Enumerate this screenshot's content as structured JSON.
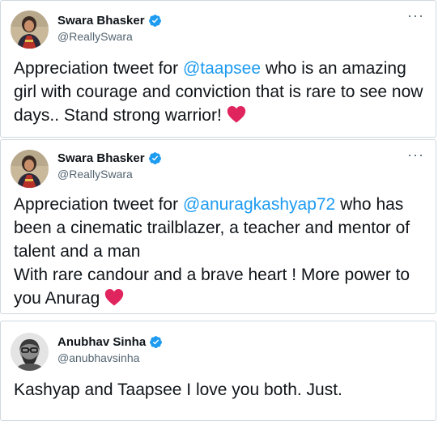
{
  "tweets": [
    {
      "author": "Swara Bhasker",
      "handle": "@ReallySwara",
      "more_label": "···",
      "text_before": "Appreciation tweet for ",
      "mention": "@taapsee",
      "text_after": " who is an amazing girl with courage and conviction that is rare to see now days.. Stand strong warrior!",
      "emoji": "red-heart",
      "avatar": "woman-portrait-avatar"
    },
    {
      "author": "Swara Bhasker",
      "handle": "@ReallySwara",
      "more_label": "···",
      "text_before": "Appreciation tweet for ",
      "mention": "@anuragkashyap72",
      "text_after": " who has been a cinematic trailblazer, a teacher and mentor of talent and a man",
      "text_line2": "With rare candour and a brave heart ! More power to you Anurag",
      "emoji": "red-heart",
      "avatar": "woman-portrait-avatar"
    },
    {
      "author": "Anubhav Sinha",
      "handle": "@anubhavsinha",
      "more_label": "",
      "text": "Kashyap and Taapsee I love you both. Just.",
      "avatar": "man-with-glasses-avatar"
    }
  ],
  "colors": {
    "link": "#1d9bf0",
    "verified": "#1d9bf0",
    "heart": "#e0245e",
    "muted": "#536471"
  }
}
